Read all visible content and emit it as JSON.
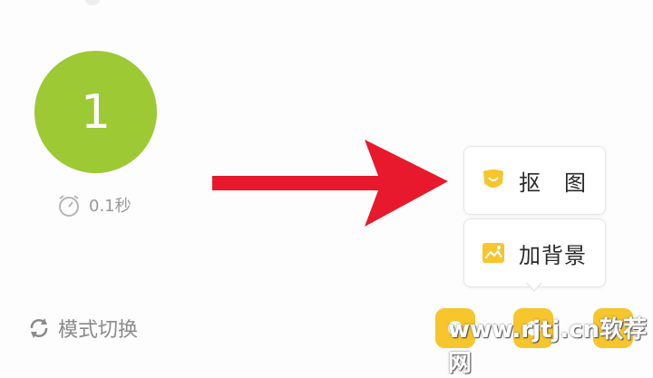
{
  "theme": {
    "green": "#9cc934",
    "yellow": "#f7c52c",
    "arrow_red": "#e8192c"
  },
  "counter": {
    "value": "1"
  },
  "timer": {
    "text": "0.1秒",
    "icon": "stopwatch-icon"
  },
  "mode_switch": {
    "label": "模式切换",
    "icon": "refresh-icon"
  },
  "popup_menu": {
    "items": [
      {
        "label": "抠　图",
        "icon": "shield-icon"
      },
      {
        "label": "加背景",
        "icon": "image-icon"
      }
    ]
  },
  "toolbar": {
    "buttons": [
      "tool-button-1",
      "tool-button-2",
      "tool-button-3"
    ]
  },
  "watermark": {
    "text": "www.rjtj.cn软荐网"
  }
}
